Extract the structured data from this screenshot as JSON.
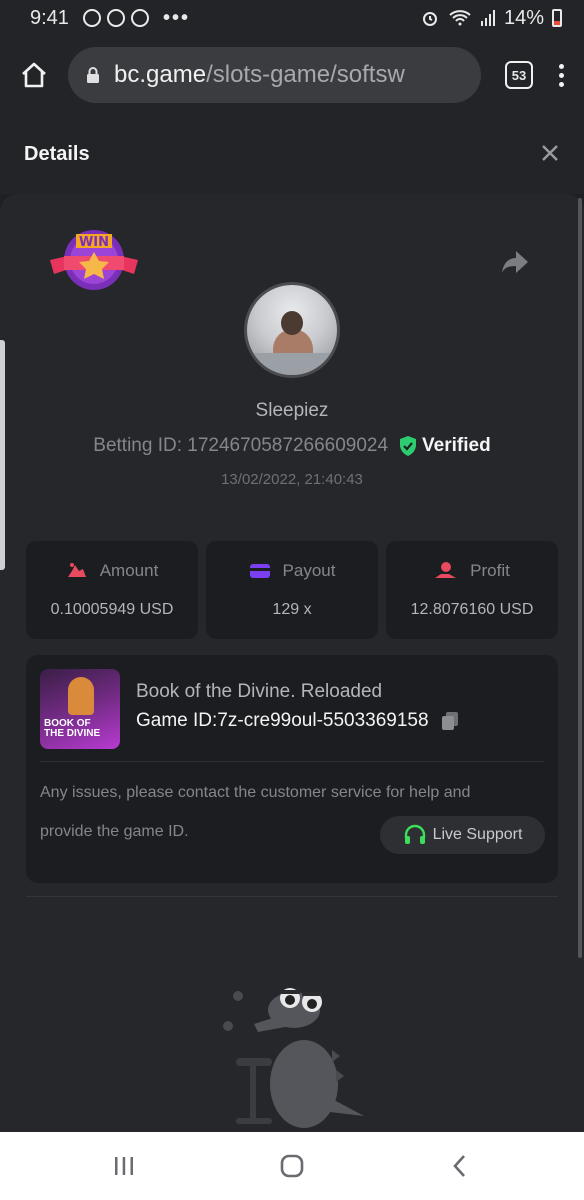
{
  "status_bar": {
    "time": "9:41",
    "dots": "•••",
    "battery": "14%",
    "icons": [
      "whatsapp-icon",
      "messenger-icon",
      "messenger-icon",
      "alarm-icon",
      "wifi-icon",
      "signal-icon",
      "battery-icon"
    ]
  },
  "browser": {
    "url_host": "bc.game",
    "url_path": "/slots-game/softsw",
    "tab_count": "53"
  },
  "modal": {
    "title": "Details",
    "close_icon": "close-icon"
  },
  "profile": {
    "username": "Sleepiez",
    "betting_id": "Betting ID: 1724670587266609024",
    "verified_label": "Verified",
    "timestamp": "13/02/2022, 21:40:43"
  },
  "stats": {
    "amount_label": "Amount",
    "amount_value": "0.10005949 USD",
    "payout_label": "Payout",
    "payout_value": "129 x",
    "profit_label": "Profit",
    "profit_value": "12.8076160 USD"
  },
  "game": {
    "name": "Book of the Divine. Reloaded",
    "game_id": "Game ID:7z-cre99oul-5503369158",
    "issue_line1": "Any issues, please contact the customer service for help and",
    "issue_line2": "provide the game ID.",
    "support_label": "Live Support"
  },
  "colors": {
    "background": "#1f2024",
    "card": "#1c1d20",
    "verified": "#2ecc71",
    "amount_icon": "#e84a5f",
    "payout_icon": "#7b3ff2",
    "profit_icon": "#e84a5f",
    "support_icon": "#3ddc5a"
  }
}
